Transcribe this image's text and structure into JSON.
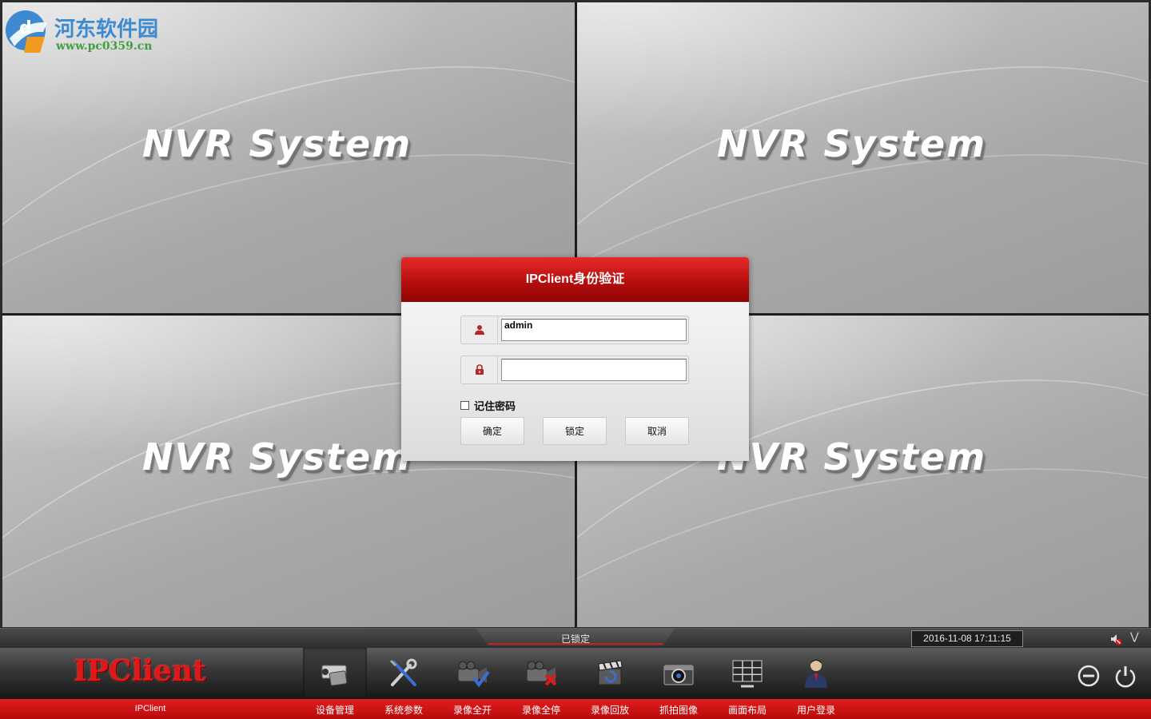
{
  "watermark": {
    "title": "河东软件园",
    "url": "www.pc0359.cn"
  },
  "panes": [
    {
      "label": "NVR System"
    },
    {
      "label": "NVR System"
    },
    {
      "label": "NVR System"
    },
    {
      "label": "NVR System"
    }
  ],
  "dialog": {
    "title": "IPClient身份验证",
    "username": "admin",
    "password": "",
    "remember_label": "记住密码",
    "remember_checked": false,
    "ok_label": "确定",
    "lock_label": "锁定",
    "cancel_label": "取消",
    "user_icon": "user-icon",
    "lock_icon": "padlock-icon"
  },
  "status": {
    "text": "已锁定",
    "datetime": "2016-11-08 17:11:15"
  },
  "toolbar": {
    "brand": "IPClient",
    "app_label": "IPClient",
    "items": [
      {
        "label": "设备管理",
        "icon": "camera-icon",
        "active": true
      },
      {
        "label": "系统参数",
        "icon": "tools-icon"
      },
      {
        "label": "录像全开",
        "icon": "record-start-icon"
      },
      {
        "label": "录像全停",
        "icon": "record-stop-icon"
      },
      {
        "label": "录像回放",
        "icon": "playback-icon"
      },
      {
        "label": "抓拍图像",
        "icon": "snapshot-icon"
      },
      {
        "label": "画面布局",
        "icon": "layout-icon"
      },
      {
        "label": "用户登录",
        "icon": "user-login-icon"
      }
    ]
  },
  "colors": {
    "accent": "#c81414",
    "dialog_header": "#b30c0c",
    "watermark_blue": "#3d8ad0",
    "watermark_green": "#3ea03e"
  }
}
